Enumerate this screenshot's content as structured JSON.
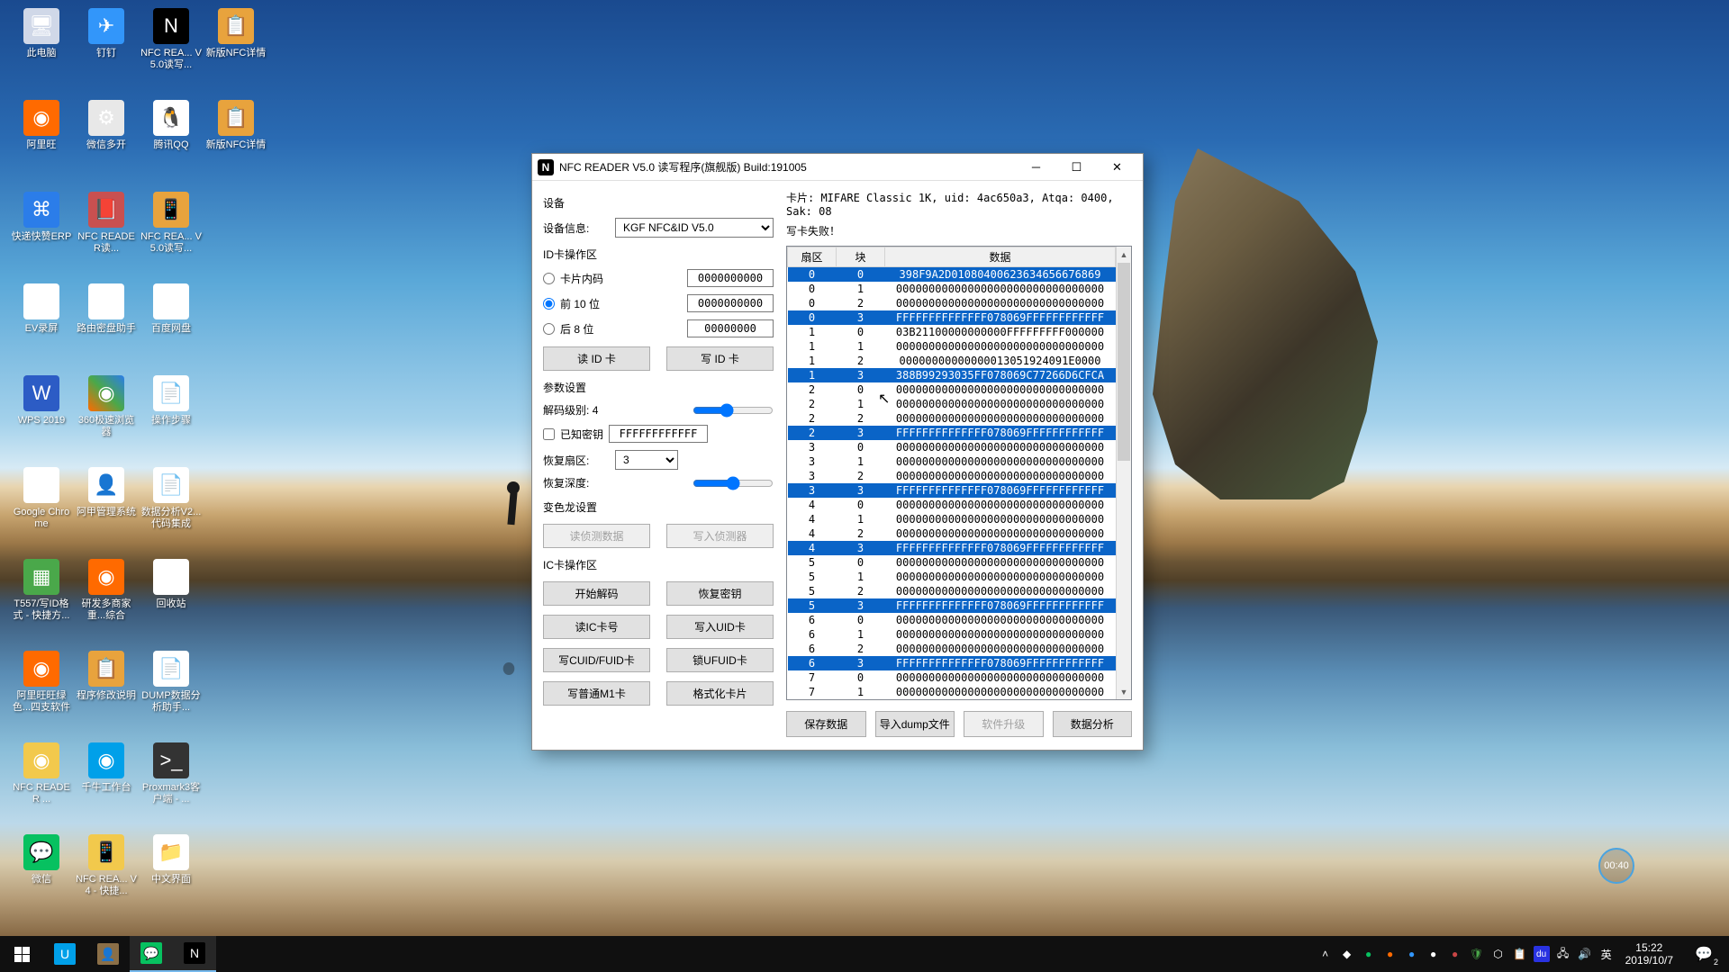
{
  "window": {
    "title": "NFC READER V5.0 读写程序(旗舰版) Build:191005",
    "device_section": "设备",
    "device_info_label": "设备信息:",
    "device_combo_value": "KGF NFC&ID V5.0",
    "id_section": "ID卡操作区",
    "radio_card_internal": "卡片内码",
    "radio_first10": "前 10 位",
    "radio_last8": "后  8 位",
    "id_val1": "0000000000",
    "id_val2": "0000000000",
    "id_val3": "00000000",
    "btn_read_id": "读 ID 卡",
    "btn_write_id": "写 ID 卡",
    "param_section": "参数设置",
    "decode_level_label": "解码级别:",
    "decode_level_value": "4",
    "known_key_label": "已知密钥",
    "known_key_value": "FFFFFFFFFFFF",
    "recover_sector_label": "恢复扇区:",
    "recover_sector_value": "3",
    "recover_depth_label": "恢复深度:",
    "chameleon_section": "变色龙设置",
    "btn_read_detector": "读侦测数据",
    "btn_write_detector": "写入侦测器",
    "ic_section": "IC卡操作区",
    "btn_start_decode": "开始解码",
    "btn_recover_key": "恢复密钥",
    "btn_read_ic": "读IC卡号",
    "btn_write_uid": "写入UID卡",
    "btn_write_cuid": "写CUID/FUID卡",
    "btn_lock_ufuid": "锁UFUID卡",
    "btn_write_m1": "写普通M1卡",
    "btn_format": "格式化卡片",
    "card_info": "卡片: MIFARE Classic 1K, uid: 4ac650a3,  Atqa: 0400,  Sak: 08",
    "status": "写卡失败！",
    "col_sector": "扇区",
    "col_block": "块",
    "col_data": "数据",
    "btn_save_data": "保存数据",
    "btn_import_dump": "导入dump文件",
    "btn_software_upgrade": "软件升级",
    "btn_data_analysis": "数据分析"
  },
  "grid_rows": [
    {
      "s": "0",
      "b": "0",
      "d": "398F9A2D01080400623634656676869",
      "hl": "first"
    },
    {
      "s": "0",
      "b": "1",
      "d": "00000000000000000000000000000000"
    },
    {
      "s": "0",
      "b": "2",
      "d": "00000000000000000000000000000000"
    },
    {
      "s": "0",
      "b": "3",
      "d": "FFFFFFFFFFFFFF078069FFFFFFFFFFFF",
      "hl": "hl"
    },
    {
      "s": "1",
      "b": "0",
      "d": "03B21100000000000FFFFFFFFF000000"
    },
    {
      "s": "1",
      "b": "1",
      "d": "00000000000000000000000000000000"
    },
    {
      "s": "1",
      "b": "2",
      "d": "00000000000000013051924091E0000"
    },
    {
      "s": "1",
      "b": "3",
      "d": "388B99293035FF078069C77266D6CFCA",
      "hl": "hl"
    },
    {
      "s": "2",
      "b": "0",
      "d": "00000000000000000000000000000000"
    },
    {
      "s": "2",
      "b": "1",
      "d": "00000000000000000000000000000000"
    },
    {
      "s": "2",
      "b": "2",
      "d": "00000000000000000000000000000000"
    },
    {
      "s": "2",
      "b": "3",
      "d": "FFFFFFFFFFFFFF078069FFFFFFFFFFFF",
      "hl": "hl"
    },
    {
      "s": "3",
      "b": "0",
      "d": "00000000000000000000000000000000"
    },
    {
      "s": "3",
      "b": "1",
      "d": "00000000000000000000000000000000"
    },
    {
      "s": "3",
      "b": "2",
      "d": "00000000000000000000000000000000"
    },
    {
      "s": "3",
      "b": "3",
      "d": "FFFFFFFFFFFFFF078069FFFFFFFFFFFF",
      "hl": "hl"
    },
    {
      "s": "4",
      "b": "0",
      "d": "00000000000000000000000000000000"
    },
    {
      "s": "4",
      "b": "1",
      "d": "00000000000000000000000000000000"
    },
    {
      "s": "4",
      "b": "2",
      "d": "00000000000000000000000000000000"
    },
    {
      "s": "4",
      "b": "3",
      "d": "FFFFFFFFFFFFFF078069FFFFFFFFFFFF",
      "hl": "hl"
    },
    {
      "s": "5",
      "b": "0",
      "d": "00000000000000000000000000000000"
    },
    {
      "s": "5",
      "b": "1",
      "d": "00000000000000000000000000000000"
    },
    {
      "s": "5",
      "b": "2",
      "d": "00000000000000000000000000000000"
    },
    {
      "s": "5",
      "b": "3",
      "d": "FFFFFFFFFFFFFF078069FFFFFFFFFFFF",
      "hl": "hl"
    },
    {
      "s": "6",
      "b": "0",
      "d": "00000000000000000000000000000000"
    },
    {
      "s": "6",
      "b": "1",
      "d": "00000000000000000000000000000000"
    },
    {
      "s": "6",
      "b": "2",
      "d": "00000000000000000000000000000000"
    },
    {
      "s": "6",
      "b": "3",
      "d": "FFFFFFFFFFFFFF078069FFFFFFFFFFFF",
      "hl": "hl"
    },
    {
      "s": "7",
      "b": "0",
      "d": "00000000000000000000000000000000"
    },
    {
      "s": "7",
      "b": "1",
      "d": "00000000000000000000000000000000"
    }
  ],
  "desktop_icons": [
    {
      "label": "此电脑",
      "bg": "#d0d8e8",
      "c": "🖥"
    },
    {
      "label": "钉钉",
      "bg": "#3296fa",
      "c": "✈"
    },
    {
      "label": "NFC REA... V5.0读写...",
      "bg": "#000",
      "c": "N"
    },
    {
      "label": "新版NFC详情",
      "bg": "#e8a33d",
      "c": "📋"
    },
    {
      "label": "",
      "bg": "transparent",
      "c": ""
    },
    {
      "label": "阿里旺",
      "bg": "#ff6a00",
      "c": "◉"
    },
    {
      "label": "微信多开",
      "bg": "#e8e8e8",
      "c": "⚙"
    },
    {
      "label": "腾讯QQ",
      "bg": "#fff",
      "c": "🐧"
    },
    {
      "label": "新版NFC详情",
      "bg": "#e8a33d",
      "c": "📋"
    },
    {
      "label": "",
      "bg": "transparent",
      "c": ""
    },
    {
      "label": "快递快赞ERP",
      "bg": "#2b7de9",
      "c": "⌘"
    },
    {
      "label": "NFC READER读...",
      "bg": "#c95050",
      "c": "📕"
    },
    {
      "label": "NFC REA... V5.0读写...",
      "bg": "#e8a33d",
      "c": "📱"
    },
    {
      "label": "",
      "bg": "transparent",
      "c": ""
    },
    {
      "label": "",
      "bg": "transparent",
      "c": ""
    },
    {
      "label": "EV录屏",
      "bg": "#fff",
      "c": "◉"
    },
    {
      "label": "路由密盘助手",
      "bg": "#fff",
      "c": "🖨"
    },
    {
      "label": "百度网盘",
      "bg": "#fff",
      "c": "∞"
    },
    {
      "label": "",
      "bg": "transparent",
      "c": ""
    },
    {
      "label": "",
      "bg": "transparent",
      "c": ""
    },
    {
      "label": "WPS 2019",
      "bg": "#2c5cc5",
      "c": "W"
    },
    {
      "label": "360极速浏览器",
      "bg": "linear",
      "c": "◉"
    },
    {
      "label": "操作步骤",
      "bg": "#fff",
      "c": "📄"
    },
    {
      "label": "",
      "bg": "transparent",
      "c": ""
    },
    {
      "label": "",
      "bg": "transparent",
      "c": ""
    },
    {
      "label": "Google Chrome",
      "bg": "#fff",
      "c": "◉"
    },
    {
      "label": "阿甲管理系统",
      "bg": "#fff",
      "c": "👤"
    },
    {
      "label": "数据分析V2...代码集成",
      "bg": "#fff",
      "c": "📄"
    },
    {
      "label": "",
      "bg": "transparent",
      "c": ""
    },
    {
      "label": "",
      "bg": "transparent",
      "c": ""
    },
    {
      "label": "T557/写ID格式 - 快捷方...",
      "bg": "#4aa84a",
      "c": "▦"
    },
    {
      "label": "研发多商家重...综合",
      "bg": "#ff6a00",
      "c": "◉"
    },
    {
      "label": "回收站",
      "bg": "#fff",
      "c": "🗑"
    },
    {
      "label": "",
      "bg": "transparent",
      "c": ""
    },
    {
      "label": "",
      "bg": "transparent",
      "c": ""
    },
    {
      "label": "阿里旺旺绿色...四支软件",
      "bg": "#ff6a00",
      "c": "◉"
    },
    {
      "label": "程序修改说明",
      "bg": "#e8a33d",
      "c": "📋"
    },
    {
      "label": "DUMP数据分析助手...",
      "bg": "#fff",
      "c": "📄"
    },
    {
      "label": "",
      "bg": "transparent",
      "c": ""
    },
    {
      "label": "",
      "bg": "transparent",
      "c": ""
    },
    {
      "label": "NFC READER ...",
      "bg": "#f2c94c",
      "c": "◉"
    },
    {
      "label": "千牛工作台",
      "bg": "#00a0e9",
      "c": "◉"
    },
    {
      "label": "Proxmark3客户端 - ...",
      "bg": "#333",
      "c": ">_"
    },
    {
      "label": "",
      "bg": "transparent",
      "c": ""
    },
    {
      "label": "",
      "bg": "transparent",
      "c": ""
    },
    {
      "label": "微信",
      "bg": "#07c160",
      "c": "💬"
    },
    {
      "label": "NFC REA... V4 - 快捷...",
      "bg": "#f2c94c",
      "c": "📱"
    },
    {
      "label": "中文界面",
      "bg": "#fff",
      "c": "📁"
    }
  ],
  "taskbar": {
    "time": "15:22",
    "date": "2019/10/7",
    "ime": "英",
    "notif_count": "2"
  },
  "timer_badge": "00:40"
}
